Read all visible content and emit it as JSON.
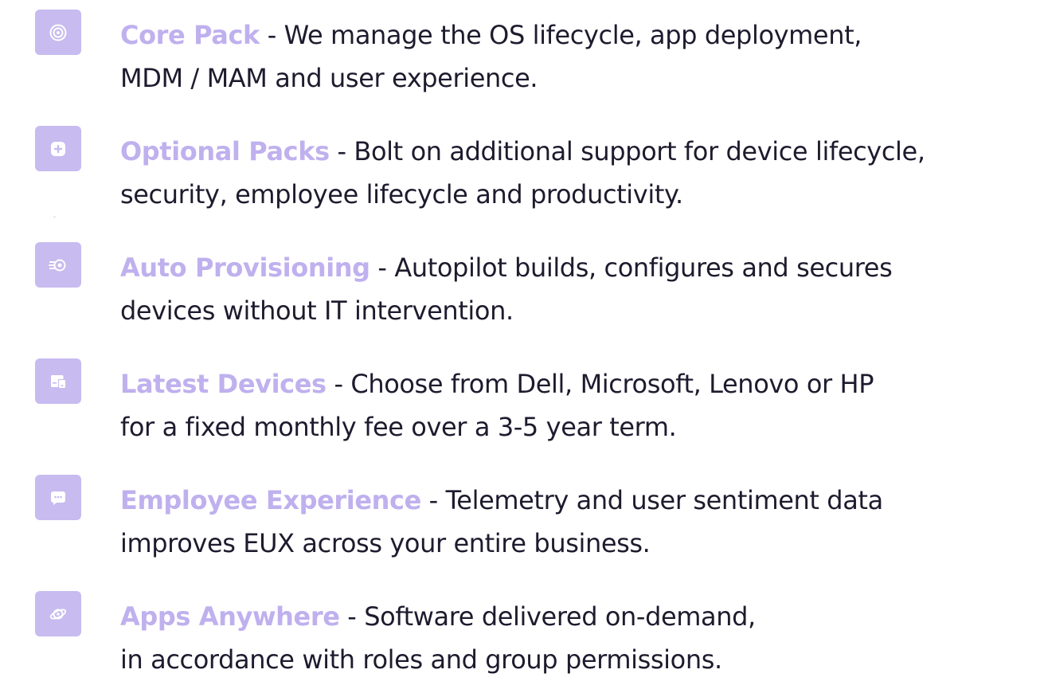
{
  "accent_color": "#bfb0ee",
  "tile_color": "#c7bbf0",
  "features": [
    {
      "icon": "target-icon",
      "title": "Core Pack",
      "line1": " - We manage the OS lifecycle, app deployment,",
      "line2": "MDM / MAM and user experience."
    },
    {
      "icon": "plus-square-icon",
      "title": "Optional Packs",
      "line1": " - Bolt on additional support for device lifecycle,",
      "line2": "security, employee lifecycle and productivity."
    },
    {
      "icon": "rocket-icon",
      "title": "Auto Provisioning",
      "line1": " - Autopilot builds, configures and secures",
      "line2": "devices without IT intervention."
    },
    {
      "icon": "devices-icon",
      "title": "Latest Devices",
      "line1": " - Choose from Dell, Microsoft, Lenovo or HP",
      "line2": "for a fixed monthly fee over a 3-5 year term."
    },
    {
      "icon": "chat-bubble-icon",
      "title": "Employee Experience",
      "line1": " - Telemetry and user sentiment data",
      "line2": "improves EUX across your entire business."
    },
    {
      "icon": "planet-icon",
      "title": "Apps Anywhere",
      "line1": " - Software delivered on-demand,",
      "line2": "in accordance with roles and group permissions."
    }
  ]
}
